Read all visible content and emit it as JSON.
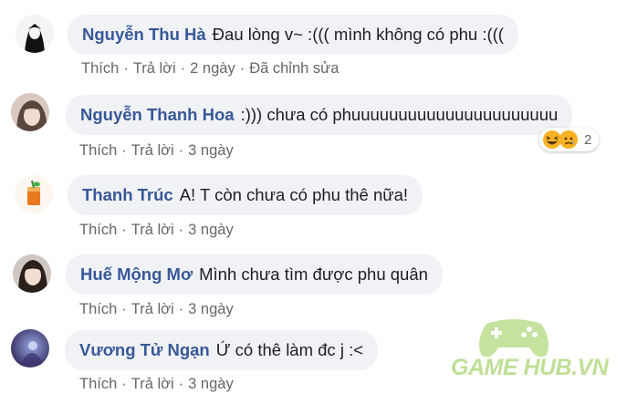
{
  "comments": [
    {
      "author": "Nguyễn Thu Hà",
      "text": "Đau lòng v~ :((( mình không có phu :(((",
      "like": "Thích",
      "reply": "Trả lời",
      "time": "2 ngày",
      "extra": "Đã chỉnh sửa"
    },
    {
      "author": "Nguyễn Thanh Hoa",
      "text": ":))) chưa có phuuuuuuuuuuuuuuuuuuuuuu",
      "like": "Thích",
      "reply": "Trả lời",
      "time": "3 ngày",
      "reaction_count": "2"
    },
    {
      "author": "Thanh Trúc",
      "text": "A! T còn chưa có phu thê nữa!",
      "like": "Thích",
      "reply": "Trả lời",
      "time": "3 ngày"
    },
    {
      "author": "Huế Mộng Mơ",
      "text": "Mình chưa tìm được phu quân",
      "like": "Thích",
      "reply": "Trả lời",
      "time": "3 ngày"
    },
    {
      "author": "Vương Tử Ngạn",
      "text": "Ứ có thê làm đc j :<",
      "like": "Thích",
      "reply": "Trả lời",
      "time": "3 ngày"
    }
  ],
  "separator": "·",
  "watermark": {
    "text": "GAME HUB.VN"
  },
  "colors": {
    "author": "#385898",
    "bubble": "#f0f2f5",
    "meta": "#65676b",
    "watermark": "#8cc63f"
  },
  "icons": {
    "reactions": [
      "haha-icon",
      "sad-icon"
    ]
  }
}
